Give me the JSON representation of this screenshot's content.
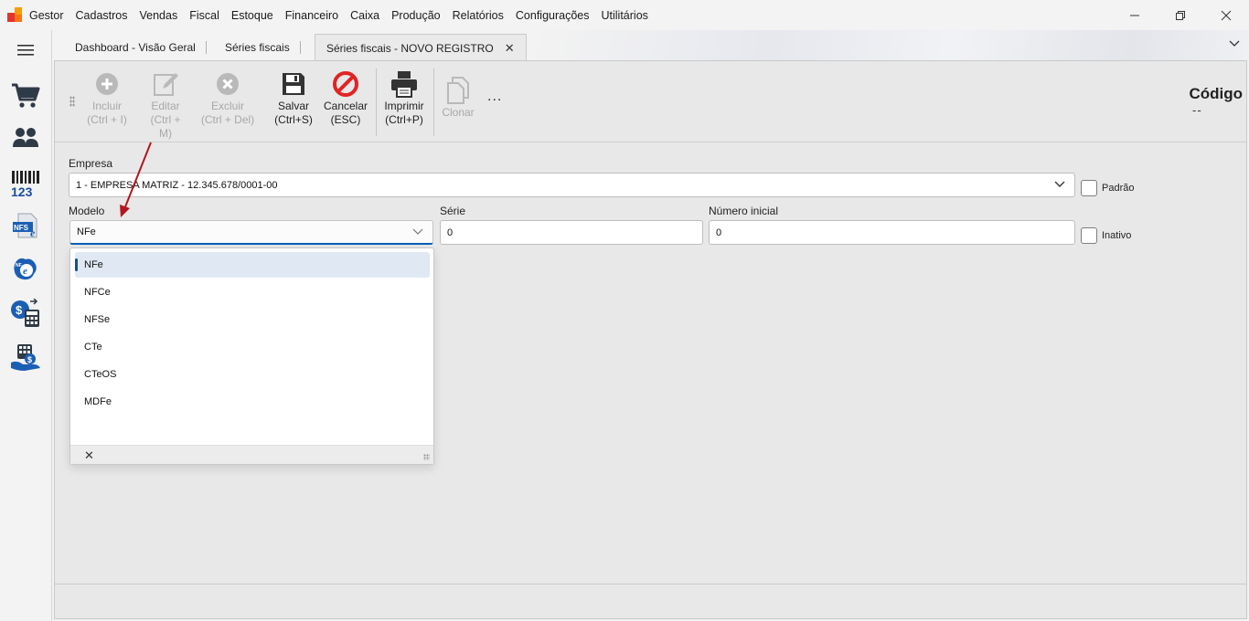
{
  "menu": {
    "items": [
      "Gestor",
      "Cadastros",
      "Vendas",
      "Fiscal",
      "Estoque",
      "Financeiro",
      "Caixa",
      "Produção",
      "Relatórios",
      "Configurações",
      "Utilitários"
    ]
  },
  "window": {
    "minimize": "—",
    "restore": "❐",
    "close": "✕"
  },
  "sidebar": {
    "icons": [
      "cart-icon",
      "users-icon",
      "barcode-icon",
      "nfse-icon",
      "nfe-icon",
      "financial-calculator-icon",
      "cash-register-icon"
    ]
  },
  "tabs": [
    {
      "label": "Dashboard - Visão Geral"
    },
    {
      "label": "Séries fiscais"
    },
    {
      "label": "Séries fiscais - NOVO REGISTRO",
      "close": "✕"
    }
  ],
  "tabs_overflow": "⌄",
  "toolbar": {
    "incluir": {
      "label": "Incluir",
      "shortcut": "(Ctrl + I)"
    },
    "editar": {
      "label": "Editar",
      "shortcut": "(Ctrl + M)"
    },
    "excluir": {
      "label": "Excluir",
      "shortcut": "(Ctrl + Del)"
    },
    "salvar": {
      "label": "Salvar",
      "shortcut": "(Ctrl+S)"
    },
    "cancelar": {
      "label": "Cancelar",
      "shortcut": "(ESC)"
    },
    "imprimir": {
      "label": "Imprimir",
      "shortcut": "(Ctrl+P)"
    },
    "clonar": {
      "label": "Clonar"
    },
    "more": "..."
  },
  "record": {
    "codigo_label": "Código",
    "codigo_value": "--"
  },
  "form": {
    "empresa": {
      "label": "Empresa",
      "value": "1 - EMPRESA MATRIZ - 12.345.678/0001-00"
    },
    "padrao": {
      "label": "Padrão"
    },
    "modelo": {
      "label": "Modelo",
      "value": "NFe"
    },
    "serie": {
      "label": "Série",
      "value": "0"
    },
    "numero_inicial": {
      "label": "Número inicial",
      "value": "0"
    },
    "inativo": {
      "label": "Inativo"
    }
  },
  "dropdown": {
    "options": [
      "NFe",
      "NFCe",
      "NFSe",
      "CTe",
      "CTeOS",
      "MDFe"
    ],
    "selected_index": 0,
    "clear": "✕"
  },
  "colors": {
    "annotation_arrow": "#b3161c",
    "focus_accent": "#005fb8"
  }
}
